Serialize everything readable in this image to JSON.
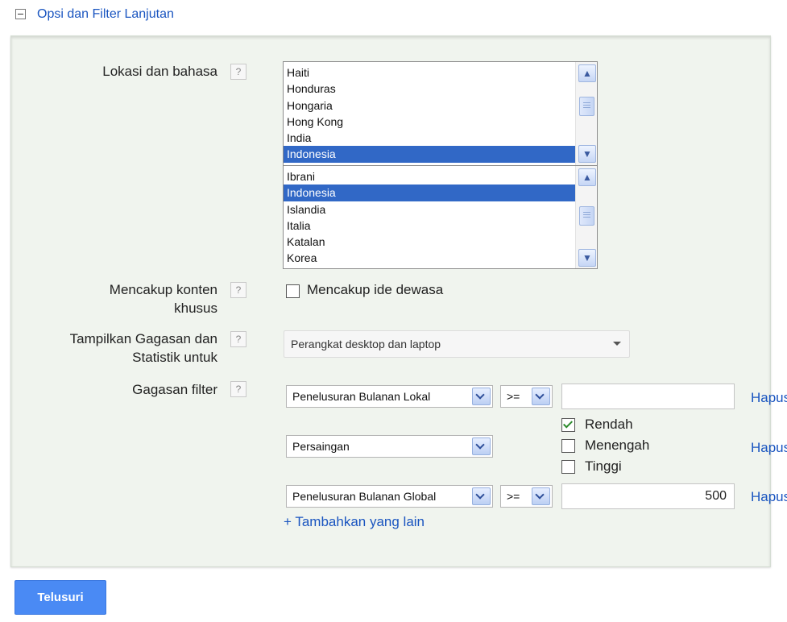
{
  "header": {
    "title": "Opsi dan Filter Lanjutan"
  },
  "location_language": {
    "label": "Lokasi dan bahasa",
    "help_label": "?",
    "countries": [
      {
        "label": "Haiti",
        "selected": false
      },
      {
        "label": "Honduras",
        "selected": false
      },
      {
        "label": "Hongaria",
        "selected": false
      },
      {
        "label": "Hong Kong",
        "selected": false
      },
      {
        "label": "India",
        "selected": false
      },
      {
        "label": "Indonesia",
        "selected": true
      }
    ],
    "languages": [
      {
        "label": "Ibrani",
        "selected": false
      },
      {
        "label": "Indonesia",
        "selected": true
      },
      {
        "label": "Islandia",
        "selected": false
      },
      {
        "label": "Italia",
        "selected": false
      },
      {
        "label": "Katalan",
        "selected": false
      },
      {
        "label": "Korea",
        "selected": false
      }
    ]
  },
  "special_content": {
    "label_line1": "Mencakup konten",
    "label_line2": "khusus",
    "help_label": "?",
    "checkbox_label": "Mencakup ide dewasa",
    "checked": false
  },
  "show_ideas": {
    "label_line1": "Tampilkan Gagasan dan",
    "label_line2": "Statistik untuk",
    "help_label": "?",
    "selected": "Perangkat desktop dan laptop"
  },
  "filters": {
    "label": "Gagasan filter",
    "help_label": "?",
    "rows": [
      {
        "field": "Penelusuran Bulanan Lokal",
        "operator": ">=",
        "value": "",
        "remove": "Hapus"
      },
      {
        "field": "Persaingan",
        "options": [
          {
            "label": "Rendah",
            "checked": true
          },
          {
            "label": "Menengah",
            "checked": false
          },
          {
            "label": "Tinggi",
            "checked": false
          }
        ],
        "remove": "Hapus"
      },
      {
        "field": "Penelusuran Bulanan Global",
        "operator": ">=",
        "value": "500",
        "remove": "Hapus"
      }
    ],
    "add_more": "+ Tambahkan yang lain"
  },
  "search_button": "Telusuri",
  "colors": {
    "link": "#1a55c0",
    "selection": "#3168c6",
    "button": "#4a8af4",
    "panel": "#f0f4ee"
  }
}
